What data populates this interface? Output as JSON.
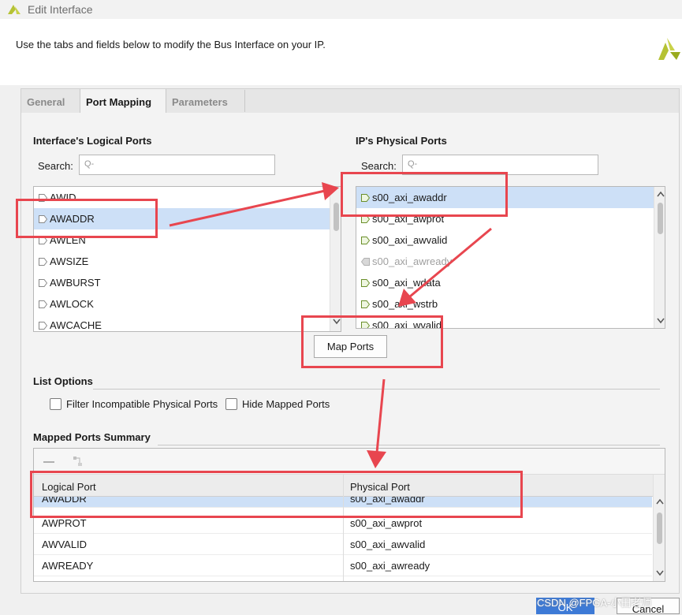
{
  "window": {
    "title": "Edit Interface"
  },
  "header": {
    "description": "Use the tabs and fields below to modify the Bus Interface on your IP."
  },
  "tabs": [
    {
      "label": "General",
      "active": false
    },
    {
      "label": "Port Mapping",
      "active": true
    },
    {
      "label": "Parameters",
      "active": false
    }
  ],
  "logical_ports": {
    "title": "Interface's Logical Ports",
    "search_label": "Search:",
    "search_glyph": "Q-",
    "items": [
      "AWID",
      "AWADDR",
      "AWLEN",
      "AWSIZE",
      "AWBURST",
      "AWLOCK",
      "AWCACHE"
    ],
    "selected": "AWADDR"
  },
  "physical_ports": {
    "title": "IP's Physical Ports",
    "search_label": "Search:",
    "search_glyph": "Q-",
    "items": [
      "s00_axi_awaddr",
      "s00_axi_awprot",
      "s00_axi_awvalid",
      "s00_axi_awready",
      "s00_axi_wdata",
      "s00_axi_wstrb",
      "s00_axi_wvalid"
    ],
    "selected": "s00_axi_awaddr"
  },
  "map_button": {
    "label": "Map Ports"
  },
  "list_options": {
    "title": "List Options",
    "filter_label": "Filter Incompatible Physical Ports",
    "hide_label": "Hide Mapped Ports"
  },
  "summary": {
    "title": "Mapped Ports Summary",
    "columns": [
      "Logical Port",
      "Physical Port"
    ],
    "rows": [
      [
        "AWADDR",
        "s00_axi_awaddr"
      ],
      [
        "AWPROT",
        "s00_axi_awprot"
      ],
      [
        "AWVALID",
        "s00_axi_awvalid"
      ],
      [
        "AWREADY",
        "s00_axi_awready"
      ]
    ]
  },
  "footer": {
    "ok_label": "OK",
    "cancel_label": "Cancel"
  },
  "watermark": "CSDN @FPGA-小田老师",
  "icons": [
    "vivado-logo-icon",
    "port-icon",
    "search-icon",
    "remove-icon",
    "map-icon",
    "scroll-up-icon",
    "scroll-down-icon"
  ],
  "colors": {
    "accent": "#e8464f",
    "selection": "#cde0f7",
    "logo": "#b5c234"
  }
}
